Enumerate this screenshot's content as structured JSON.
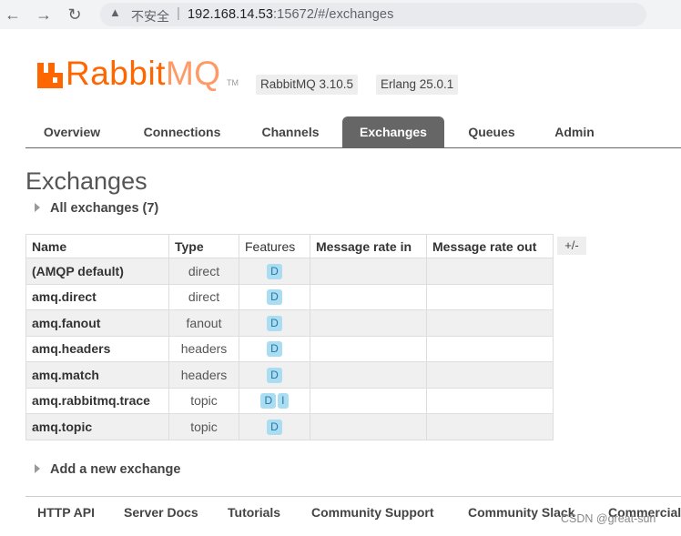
{
  "browser": {
    "insecure_label": "不安全",
    "url_host": "192.168.14.53",
    "url_path": ":15672/#/exchanges"
  },
  "header": {
    "logo_text_rabbit": "Rabbit",
    "logo_text_mq": "MQ",
    "logo_tm": "TM",
    "version_rabbitmq": "RabbitMQ 3.10.5",
    "version_erlang": "Erlang 25.0.1",
    "brand_color": "#ff6600"
  },
  "tabs": [
    {
      "label": "Overview"
    },
    {
      "label": "Connections"
    },
    {
      "label": "Channels"
    },
    {
      "label": "Exchanges",
      "active": true
    },
    {
      "label": "Queues"
    },
    {
      "label": "Admin"
    }
  ],
  "main": {
    "title": "Exchanges",
    "all_exchanges_label": "All exchanges (7)",
    "add_exchange_label": "Add a new exchange",
    "columns_toggle": "+/-",
    "table": {
      "headers": [
        "Name",
        "Type",
        "Features",
        "Message rate in",
        "Message rate out"
      ],
      "rows": [
        {
          "name": "(AMQP default)",
          "type": "direct",
          "features": [
            "D"
          ],
          "rate_in": "",
          "rate_out": ""
        },
        {
          "name": "amq.direct",
          "type": "direct",
          "features": [
            "D"
          ],
          "rate_in": "",
          "rate_out": ""
        },
        {
          "name": "amq.fanout",
          "type": "fanout",
          "features": [
            "D"
          ],
          "rate_in": "",
          "rate_out": ""
        },
        {
          "name": "amq.headers",
          "type": "headers",
          "features": [
            "D"
          ],
          "rate_in": "",
          "rate_out": ""
        },
        {
          "name": "amq.match",
          "type": "headers",
          "features": [
            "D"
          ],
          "rate_in": "",
          "rate_out": ""
        },
        {
          "name": "amq.rabbitmq.trace",
          "type": "topic",
          "features": [
            "D",
            "I"
          ],
          "rate_in": "",
          "rate_out": ""
        },
        {
          "name": "amq.topic",
          "type": "topic",
          "features": [
            "D"
          ],
          "rate_in": "",
          "rate_out": ""
        }
      ]
    }
  },
  "footer": {
    "links": [
      "HTTP API",
      "Server Docs",
      "Tutorials",
      "Community Support",
      "Community Slack",
      "Commercial"
    ]
  },
  "watermark": "CSDN @great-sun"
}
